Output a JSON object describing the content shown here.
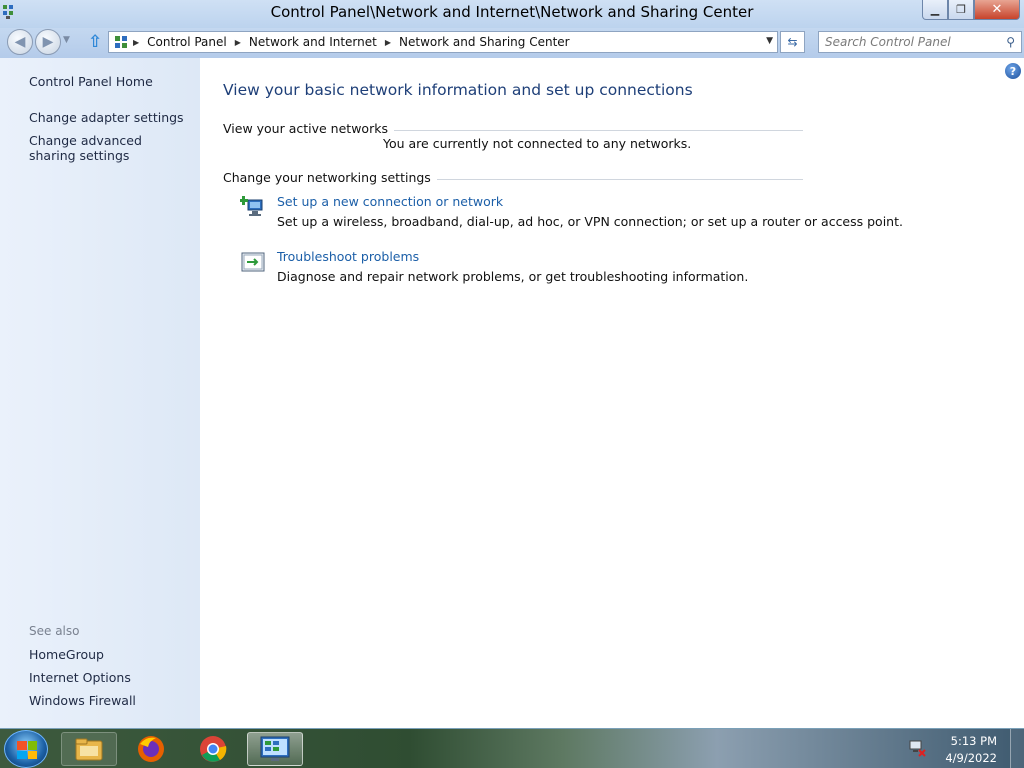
{
  "window": {
    "title": "Control Panel\\Network and Internet\\Network and Sharing Center"
  },
  "address": {
    "crumbs": [
      "Control Panel",
      "Network and Internet",
      "Network and Sharing Center"
    ],
    "search_placeholder": "Search Control Panel"
  },
  "sidebar": {
    "home": "Control Panel Home",
    "links": [
      "Change adapter settings",
      "Change advanced sharing settings"
    ],
    "see_also_label": "See also",
    "see_also": [
      "HomeGroup",
      "Internet Options",
      "Windows Firewall"
    ]
  },
  "main": {
    "heading": "View your basic network information and set up connections",
    "active_networks_label": "View your active networks",
    "not_connected": "You are currently not connected to any networks.",
    "change_settings_label": "Change your networking settings",
    "tasks": [
      {
        "title": "Set up a new connection or network",
        "description": "Set up a wireless, broadband, dial-up, ad hoc, or VPN connection; or set up a router or access point.",
        "icon": "network-setup-icon"
      },
      {
        "title": "Troubleshoot problems",
        "description": "Diagnose and repair network problems, or get troubleshooting information.",
        "icon": "troubleshoot-icon"
      }
    ]
  },
  "taskbar": {
    "items": [
      "start-button",
      "file-explorer-icon",
      "firefox-icon",
      "chrome-icon",
      "control-panel-icon"
    ],
    "time": "5:13 PM",
    "date": "4/9/2022"
  },
  "colors": {
    "link": "#1c5fa8",
    "heading": "#1e3f78",
    "sidebar_bg": "#e4edf8"
  }
}
